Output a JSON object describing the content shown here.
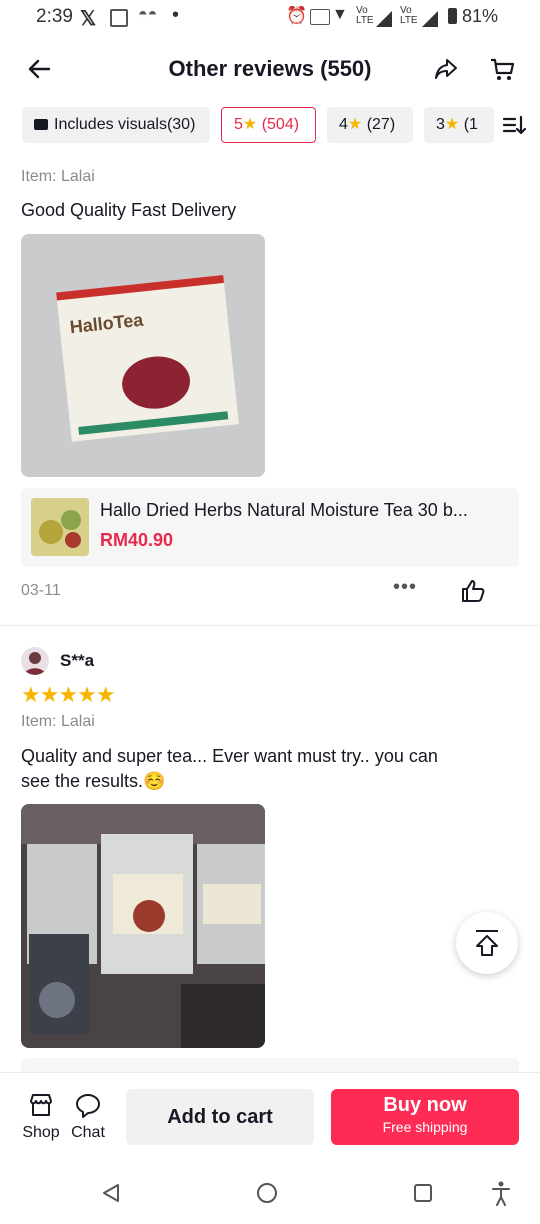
{
  "status": {
    "time": "2:39",
    "battery": "81%"
  },
  "header": {
    "title": "Other reviews (550)"
  },
  "filters": {
    "visuals": "Includes visuals(30)",
    "five": {
      "num": "5",
      "count": "(504)"
    },
    "four": {
      "num": "4",
      "count": "(27)"
    },
    "three": {
      "num": "3",
      "count": "(1"
    }
  },
  "review1": {
    "item": "Item: Lalai",
    "text": "Good Quality Fast Delivery",
    "photo_label": "HalloTea",
    "date": "03-11"
  },
  "product": {
    "name": "Hallo Dried Herbs Natural Moisture Tea 30 b...",
    "price": "RM40.90"
  },
  "review2": {
    "user": "S**a",
    "stars": "★★★★★",
    "rating": 5,
    "item": "Item: Lalai",
    "text_line1": "Quality and super tea... Ever want must try.. you can",
    "text_line2": "see the results.☺️"
  },
  "bottom": {
    "shop": "Shop",
    "chat": "Chat",
    "add_to_cart": "Add to cart",
    "buy_now": "Buy now",
    "free_shipping": "Free shipping"
  },
  "colors": {
    "accent": "#fe2c55",
    "price": "#e8294b",
    "star": "#f7b500"
  }
}
